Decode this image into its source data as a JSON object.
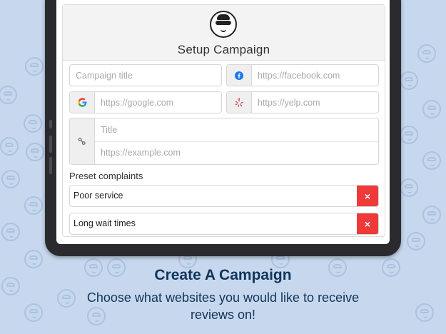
{
  "form": {
    "title": "Setup Campaign",
    "campaign_title_placeholder": "Campaign title",
    "facebook_placeholder": "https://facebook.com",
    "google_placeholder": "https://google.com",
    "yelp_placeholder": "https://yelp.com",
    "custom_title_placeholder": "Title",
    "custom_url_placeholder": "https://example.com",
    "preset_label": "Preset complaints",
    "complaints": [
      "Poor service",
      "Long wait times"
    ],
    "delete_symbol": "×"
  },
  "caption": {
    "heading": "Create A Campaign",
    "subheading": "Choose what websites you would like to receive reviews on!"
  },
  "colors": {
    "background": "#c7d8ee",
    "caption_text": "#12355b",
    "delete_red": "#ef3a3a",
    "facebook_blue": "#1877f2",
    "yelp_red": "#d32323"
  }
}
